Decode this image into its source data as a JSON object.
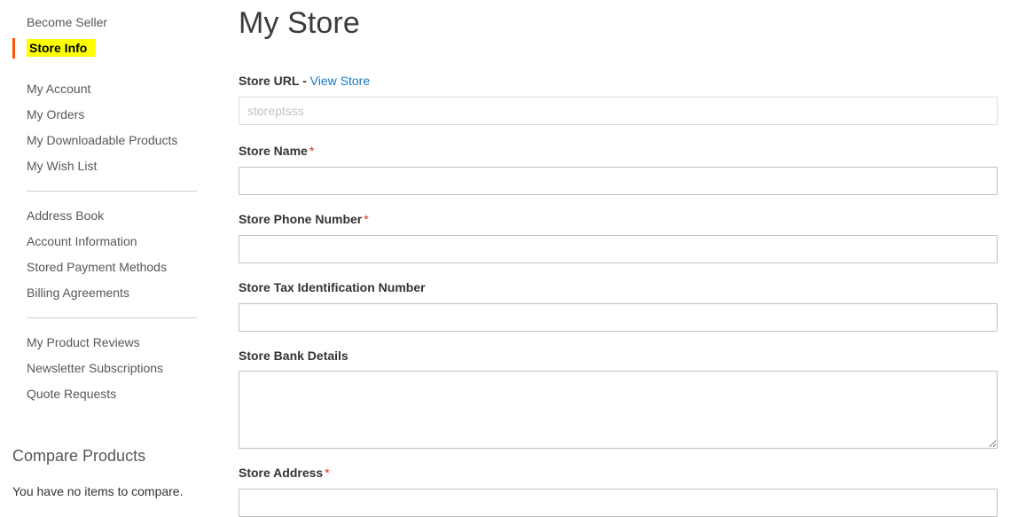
{
  "sidebar": {
    "groups": [
      {
        "items": [
          {
            "label": "Become Seller",
            "name": "sidebar-item-become-seller",
            "current": false
          },
          {
            "label": "Store Info",
            "name": "sidebar-item-store-info",
            "current": true
          }
        ]
      },
      {
        "items": [
          {
            "label": "My Account",
            "name": "sidebar-item-my-account",
            "current": false
          },
          {
            "label": "My Orders",
            "name": "sidebar-item-my-orders",
            "current": false
          },
          {
            "label": "My Downloadable Products",
            "name": "sidebar-item-my-downloadable-products",
            "current": false
          },
          {
            "label": "My Wish List",
            "name": "sidebar-item-my-wish-list",
            "current": false
          }
        ]
      },
      {
        "items": [
          {
            "label": "Address Book",
            "name": "sidebar-item-address-book",
            "current": false
          },
          {
            "label": "Account Information",
            "name": "sidebar-item-account-information",
            "current": false
          },
          {
            "label": "Stored Payment Methods",
            "name": "sidebar-item-stored-payment-methods",
            "current": false
          },
          {
            "label": "Billing Agreements",
            "name": "sidebar-item-billing-agreements",
            "current": false
          }
        ]
      },
      {
        "items": [
          {
            "label": "My Product Reviews",
            "name": "sidebar-item-my-product-reviews",
            "current": false
          },
          {
            "label": "Newsletter Subscriptions",
            "name": "sidebar-item-newsletter-subscriptions",
            "current": false
          },
          {
            "label": "Quote Requests",
            "name": "sidebar-item-quote-requests",
            "current": false
          }
        ]
      }
    ],
    "compare": {
      "title": "Compare Products",
      "empty_text": "You have no items to compare."
    },
    "highlight_color": "#ffff00",
    "current_marker_color": "#ff5501"
  },
  "main": {
    "page_title": "My Store",
    "fields": {
      "store_url": {
        "label": "Store URL",
        "separator": " - ",
        "link_label": "View Store",
        "value": "storeptsss",
        "placeholder": "storeptsss",
        "required": false,
        "disabled": true
      },
      "store_name": {
        "label": "Store Name",
        "value": "",
        "placeholder": "",
        "required": true,
        "required_mark": "*"
      },
      "store_phone": {
        "label": "Store Phone Number",
        "value": "",
        "placeholder": "",
        "required": true,
        "required_mark": "*"
      },
      "store_tax_id": {
        "label": "Store Tax Identification Number",
        "value": "",
        "placeholder": "",
        "required": false
      },
      "store_bank_details": {
        "label": "Store Bank Details",
        "value": "",
        "placeholder": "",
        "required": false
      },
      "store_address": {
        "label": "Store Address",
        "value": "",
        "placeholder": "",
        "required": true,
        "required_mark": "*"
      }
    }
  },
  "colors": {
    "link": "#1979c3",
    "required": "#e02b27",
    "text": "#333333",
    "muted": "#575757",
    "border": "#c2c2c2"
  }
}
